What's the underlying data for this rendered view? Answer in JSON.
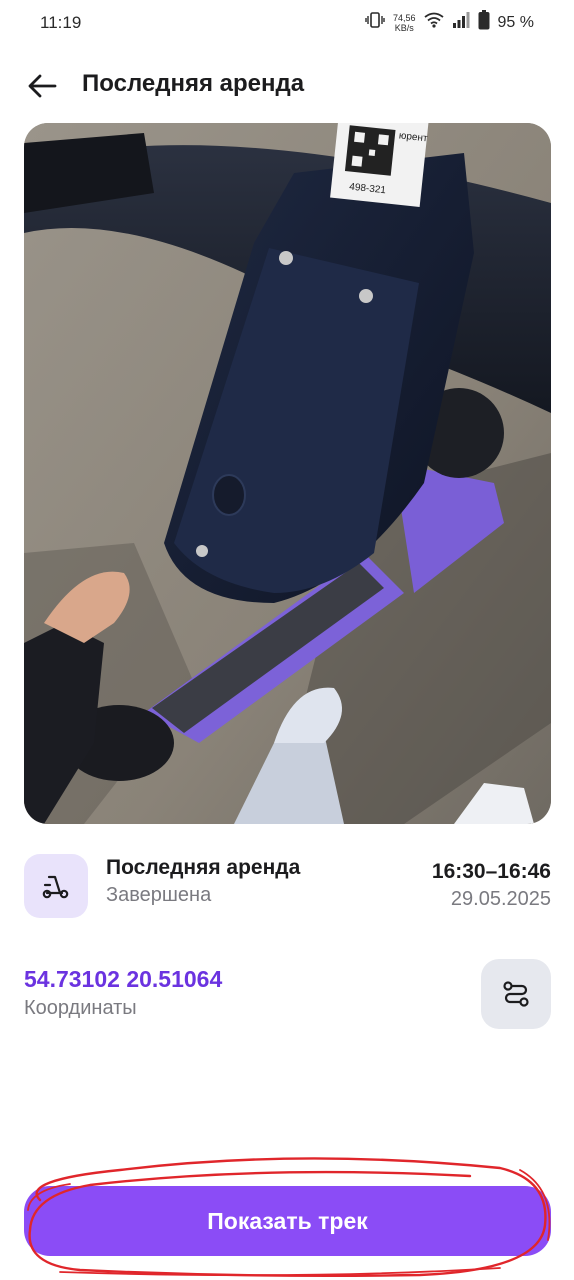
{
  "status_bar": {
    "time": "11:19",
    "net_speed_value": "74,56",
    "net_speed_unit": "KB/s",
    "battery": "95 %"
  },
  "header": {
    "title": "Последняя аренда"
  },
  "photo": {
    "sticker_text": "юрент",
    "sticker_id": "498-321"
  },
  "rental": {
    "title": "Последняя аренда",
    "status": "Завершена",
    "time_range": "16:30–16:46",
    "date": "29.05.2025"
  },
  "location": {
    "coordinates": "54.73102 20.51064",
    "label": "Координаты"
  },
  "actions": {
    "show_track_label": "Показать трек"
  },
  "colors": {
    "accent": "#8b4cf6",
    "accent_text": "#6b33e0",
    "badge_bg": "#e9e3fb",
    "secondary_btn_bg": "#e6e8ee",
    "annotation_red": "#e0262b"
  },
  "icons": {
    "back": "arrow-left-icon",
    "scooter": "scooter-icon",
    "route": "route-icon",
    "vibrate": "vibrate-icon",
    "wifi": "wifi-icon",
    "signal": "signal-icon",
    "battery": "battery-icon"
  }
}
